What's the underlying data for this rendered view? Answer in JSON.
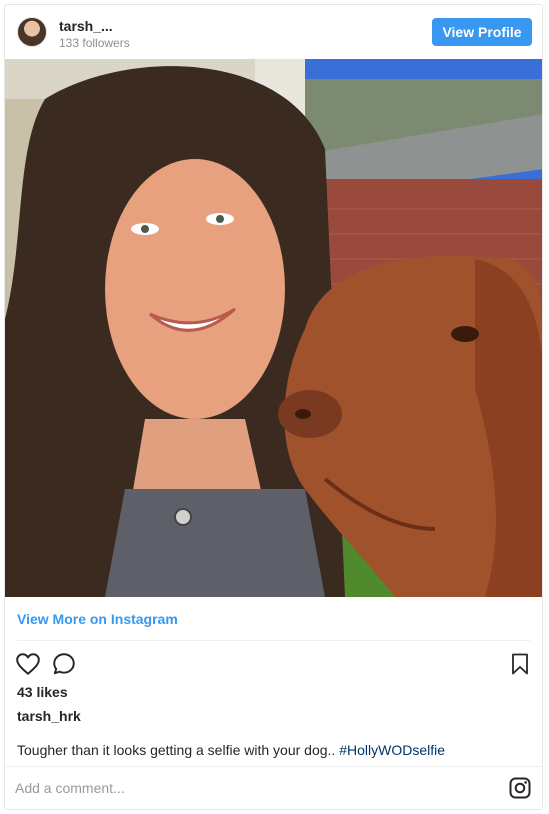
{
  "header": {
    "username": "tarsh_...",
    "followers": "133 followers",
    "view_profile_label": "View Profile"
  },
  "post": {
    "view_more_label": "View More on Instagram",
    "likes": "43 likes",
    "author": "tarsh_hrk",
    "caption_text": "Tougher than it looks getting a selfie with your dog.. ",
    "caption_hashtag": "#HollyWODselfie"
  },
  "comment_box": {
    "placeholder": "Add a comment..."
  },
  "icons": {
    "heart": "heart-icon",
    "comment": "comment-icon",
    "bookmark": "bookmark-icon",
    "instagram": "instagram-icon"
  },
  "colors": {
    "accent": "#3897f0",
    "hashtag": "#003569",
    "muted": "#8e8e8e"
  }
}
